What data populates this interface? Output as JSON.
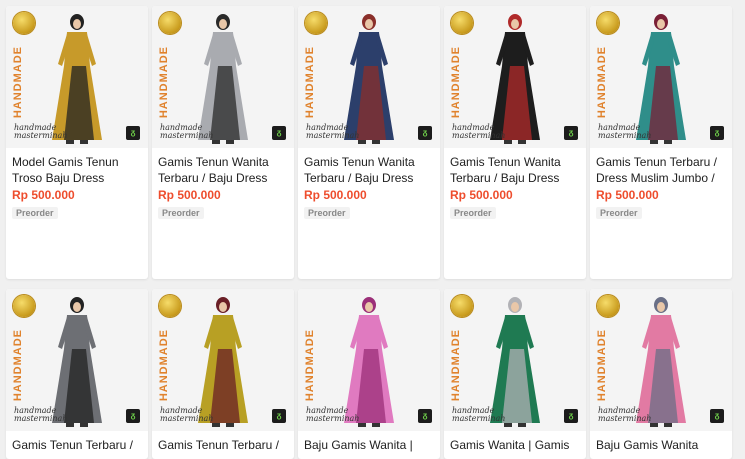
{
  "overlay": {
    "handmade_text": "HANDMADE",
    "script_line1": "handmade",
    "script_line2": "masterminah",
    "logo_text": "ᵹ"
  },
  "products": [
    {
      "title": "Model Gamis Tenun Troso Baju Dress",
      "price": "Rp 500.000",
      "tag": "Preorder",
      "colors": {
        "main": "#c79a2a",
        "accent": "#222222"
      }
    },
    {
      "title": "Gamis Tenun Wanita Terbaru / Baju Dress",
      "price": "Rp 500.000",
      "tag": "Preorder",
      "colors": {
        "main": "#a9abb0",
        "accent": "#2a2a2a"
      }
    },
    {
      "title": "Gamis Tenun Wanita Terbaru / Baju Dress",
      "price": "Rp 500.000",
      "tag": "Preorder",
      "colors": {
        "main": "#2c3f6b",
        "accent": "#8a2f2a"
      }
    },
    {
      "title": "Gamis Tenun Wanita Terbaru / Baju Dress",
      "price": "Rp 500.000",
      "tag": "Preorder",
      "colors": {
        "main": "#1d1d1d",
        "accent": "#b02a2a"
      }
    },
    {
      "title": "Gamis Tenun Terbaru / Dress Muslim Jumbo /",
      "price": "Rp 500.000",
      "tag": "Preorder",
      "colors": {
        "main": "#2f8e8a",
        "accent": "#7a1f36"
      }
    },
    {
      "title": "Gamis Tenun Terbaru /",
      "price": "",
      "tag": "",
      "colors": {
        "main": "#6d6f74",
        "accent": "#222222"
      }
    },
    {
      "title": "Gamis Tenun Terbaru /",
      "price": "",
      "tag": "",
      "colors": {
        "main": "#b8a024",
        "accent": "#6a1f26"
      }
    },
    {
      "title": "Baju Gamis Wanita |",
      "price": "",
      "tag": "",
      "colors": {
        "main": "#e07ac0",
        "accent": "#9b2f78"
      }
    },
    {
      "title": "Gamis Wanita | Gamis",
      "price": "",
      "tag": "",
      "colors": {
        "main": "#1f7a52",
        "accent": "#b2b2b6"
      }
    },
    {
      "title": "Baju Gamis Wanita",
      "price": "",
      "tag": "",
      "colors": {
        "main": "#e27aa3",
        "accent": "#6a6f86"
      }
    }
  ]
}
